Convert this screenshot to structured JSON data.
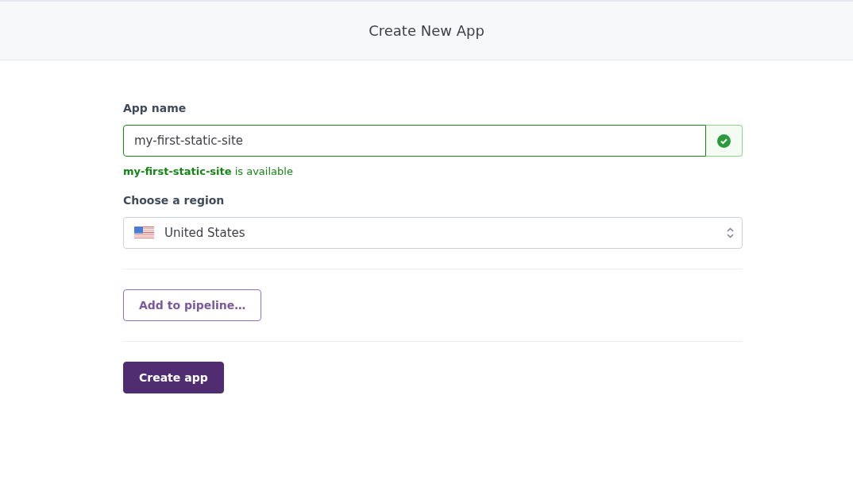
{
  "header": {
    "title": "Create New App"
  },
  "app_name": {
    "label": "App name",
    "value": "my-first-static-site",
    "valid": true,
    "message": "**my-first-static-site** is available"
  },
  "region": {
    "label": "Choose a region",
    "value": "United States"
  },
  "buttons": [
    {
      "kind": "secondary",
      "label": "Add to pipeline…"
    },
    {
      "kind": "primary",
      "label": "Create app"
    }
  ]
}
